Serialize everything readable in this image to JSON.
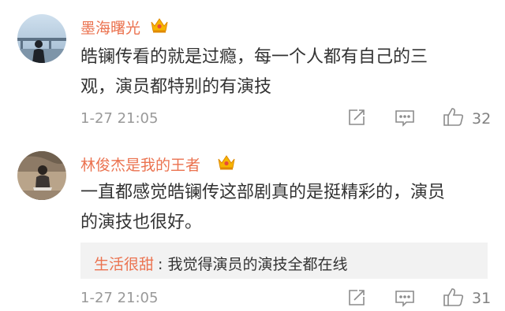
{
  "comments": [
    {
      "username": "墨海曙光",
      "text_lines": [
        "皓镧传看的就是过瘾，每一个人都有自己的三",
        "观，演员都特别的有演技"
      ],
      "time": "1-27 21:05",
      "likes": "32",
      "icons": [
        "vip-crown-icon",
        "share-icon",
        "comment-icon",
        "like-icon"
      ]
    },
    {
      "username": "林俊杰是我的王者",
      "text_lines": [
        "一直都感觉皓镧传这部剧真的是挺精彩的，演员",
        "的演技也很好。"
      ],
      "reply": {
        "name": "生活很甜",
        "text": ": 我觉得演员的演技全都在线"
      },
      "time": "1-27 21:05",
      "likes": "31",
      "icons": [
        "vip-crown-icon",
        "share-icon",
        "comment-icon",
        "like-icon"
      ]
    }
  ],
  "colors": {
    "username": "#eb7350",
    "text": "#333333",
    "meta": "#999999",
    "reply_bg": "#f2f2f2"
  }
}
